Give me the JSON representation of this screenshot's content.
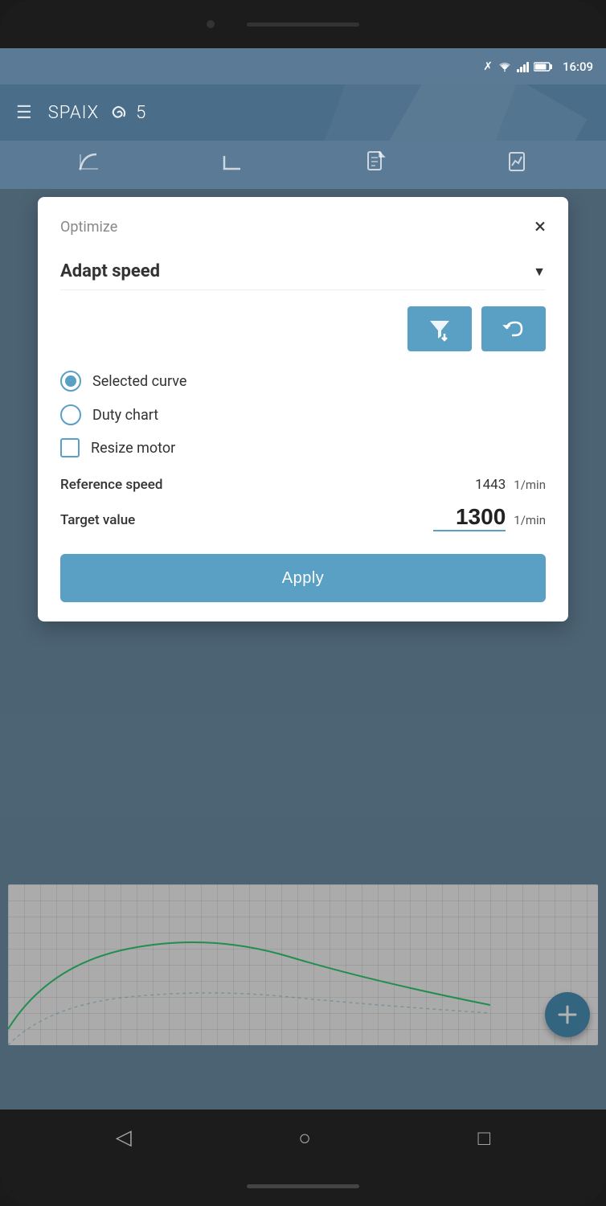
{
  "phone": {
    "status_bar": {
      "time": "16:09"
    }
  },
  "app": {
    "title": "SPAIX",
    "version": "5",
    "toolbar": {
      "icon1": "curve-icon",
      "icon2": "corner-icon",
      "icon3": "document-icon",
      "icon4": "chart-icon"
    }
  },
  "dialog": {
    "title": "Optimize",
    "close_label": "×",
    "dropdown": {
      "label_plain": "Adapt ",
      "label_bold": "speed"
    },
    "options": [
      {
        "type": "radio",
        "checked": true,
        "label": "Selected curve"
      },
      {
        "type": "radio",
        "checked": false,
        "label": "Duty chart"
      },
      {
        "type": "checkbox",
        "checked": false,
        "label": "Resize motor"
      }
    ],
    "fields": [
      {
        "label": "Reference speed",
        "value": "1443",
        "unit": "1/min",
        "editable": false
      },
      {
        "label": "Target value",
        "value": "1300",
        "unit": "1/min",
        "editable": true
      }
    ],
    "apply_button": "Apply",
    "action_btn1_icon": "filter-down-icon",
    "action_btn2_icon": "undo-icon"
  },
  "bottom_nav": {
    "back_icon": "back-triangle-icon",
    "home_icon": "home-circle-icon",
    "recent_icon": "recent-square-icon"
  }
}
